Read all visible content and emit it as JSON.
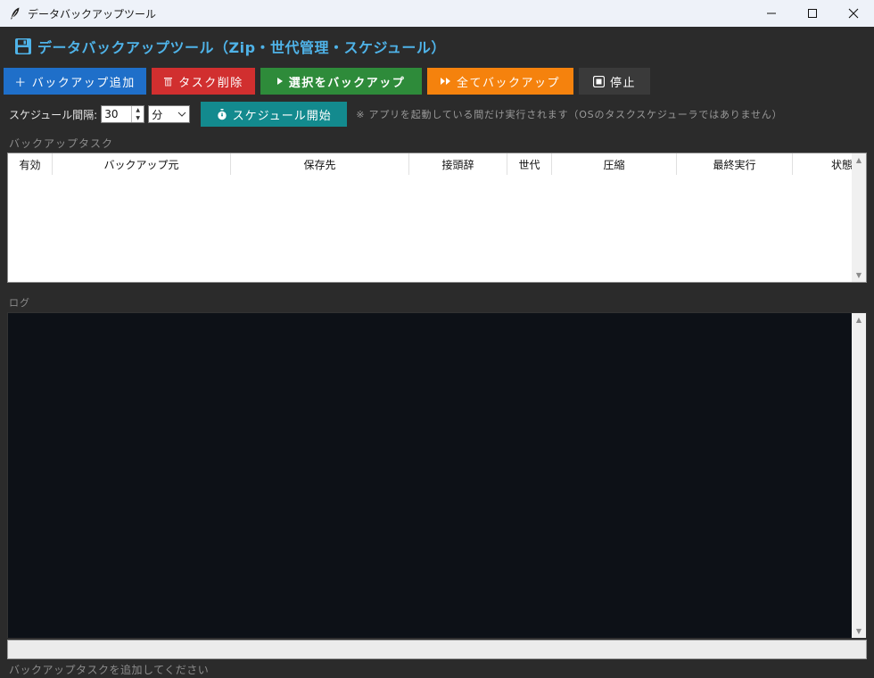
{
  "window": {
    "title": "データバックアップツール",
    "controls": [
      "minimize-icon",
      "maximize-icon",
      "close-icon"
    ]
  },
  "header": {
    "title": "データバックアップツール（Zip・世代管理・スケジュール）",
    "icon": "floppy-disk-icon",
    "accent": "#4fb3e8"
  },
  "toolbar": {
    "add_label": "＋ バックアップ追加",
    "delete_label": "タスク削除",
    "backup_selected_label": "選択をバックアップ",
    "backup_all_label": "全てバックアップ",
    "stop_label": "停止",
    "colors": {
      "add": "#1f6fc9",
      "delete": "#d12f2f",
      "backup_selected": "#2e8b3a",
      "backup_all": "#f5820d",
      "stop": "#3a3a3a"
    }
  },
  "schedule": {
    "interval_label": "スケジュール間隔:",
    "interval_value": "30",
    "unit_selected": "分",
    "start_label": "スケジュール開始",
    "note": "※ アプリを起動している間だけ実行されます（OSのタスクスケジューラではありません）",
    "start_color": "#138a8e"
  },
  "tasks": {
    "section_label": "バックアップタスク",
    "columns": [
      "有効",
      "バックアップ元",
      "保存先",
      "接頭辞",
      "世代",
      "圧縮",
      "最終実行",
      "状態"
    ],
    "rows": []
  },
  "log": {
    "section_label": "ログ",
    "lines": []
  },
  "status": {
    "text": "バックアップタスクを追加してください"
  }
}
